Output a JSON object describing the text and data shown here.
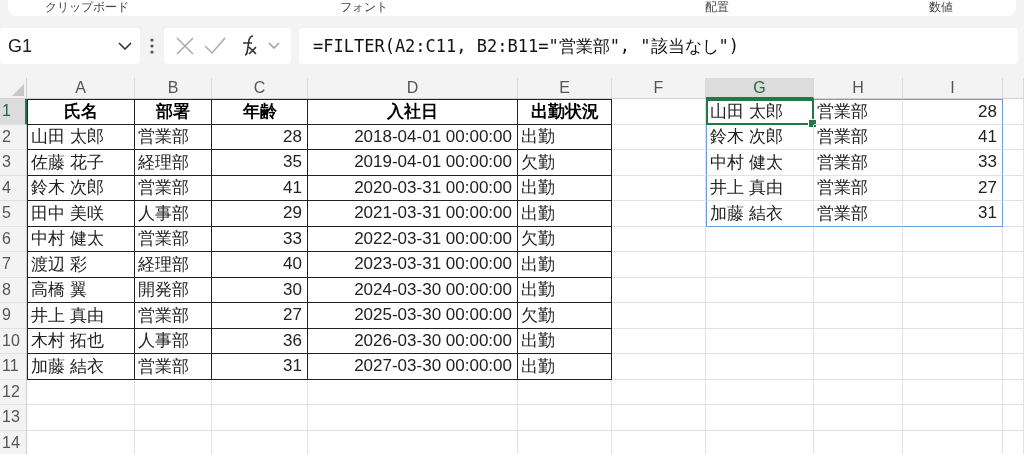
{
  "ribbon": {
    "groups": [
      "クリップボード",
      "フォント",
      "配置",
      "数値"
    ]
  },
  "formula_bar": {
    "name_box": "G1",
    "formula": "=FILTER(A2:C11, B2:B11=\"営業部\", \"該当なし\")"
  },
  "columns": [
    {
      "label": "A",
      "selected": false
    },
    {
      "label": "B",
      "selected": false
    },
    {
      "label": "C",
      "selected": false
    },
    {
      "label": "D",
      "selected": false
    },
    {
      "label": "E",
      "selected": false
    },
    {
      "label": "F",
      "selected": false
    },
    {
      "label": "G",
      "selected": true
    },
    {
      "label": "H",
      "selected": false
    },
    {
      "label": "I",
      "selected": false
    }
  ],
  "row_numbers": [
    {
      "label": "1",
      "selected": true
    },
    {
      "label": "2",
      "selected": false
    },
    {
      "label": "3",
      "selected": false
    },
    {
      "label": "4",
      "selected": false
    },
    {
      "label": "5",
      "selected": false
    },
    {
      "label": "6",
      "selected": false
    },
    {
      "label": "7",
      "selected": false
    },
    {
      "label": "8",
      "selected": false
    },
    {
      "label": "9",
      "selected": false
    },
    {
      "label": "10",
      "selected": false
    },
    {
      "label": "11",
      "selected": false
    },
    {
      "label": "12",
      "selected": false
    },
    {
      "label": "13",
      "selected": false
    },
    {
      "label": "14",
      "selected": false
    }
  ],
  "table": {
    "headers": [
      "氏名",
      "部署",
      "年齢",
      "入社日",
      "出勤状況"
    ],
    "rows": [
      [
        "山田 太郎",
        "営業部",
        "28",
        "2018-04-01 00:00:00",
        "出勤"
      ],
      [
        "佐藤 花子",
        "経理部",
        "35",
        "2019-04-01 00:00:00",
        "欠勤"
      ],
      [
        "鈴木 次郎",
        "営業部",
        "41",
        "2020-03-31 00:00:00",
        "出勤"
      ],
      [
        "田中 美咲",
        "人事部",
        "29",
        "2021-03-31 00:00:00",
        "出勤"
      ],
      [
        "中村 健太",
        "営業部",
        "33",
        "2022-03-31 00:00:00",
        "欠勤"
      ],
      [
        "渡辺 彩",
        "経理部",
        "40",
        "2023-03-31 00:00:00",
        "出勤"
      ],
      [
        "高橋 翼",
        "開発部",
        "30",
        "2024-03-30 00:00:00",
        "出勤"
      ],
      [
        "井上 真由",
        "営業部",
        "27",
        "2025-03-30 00:00:00",
        "欠勤"
      ],
      [
        "木村 拓也",
        "人事部",
        "36",
        "2026-03-30 00:00:00",
        "出勤"
      ],
      [
        "加藤 結衣",
        "営業部",
        "31",
        "2027-03-30 00:00:00",
        "出勤"
      ]
    ]
  },
  "spill": {
    "rows": [
      [
        "山田 太郎",
        "営業部",
        "28"
      ],
      [
        "鈴木 次郎",
        "営業部",
        "41"
      ],
      [
        "中村 健太",
        "営業部",
        "33"
      ],
      [
        "井上 真由",
        "営業部",
        "27"
      ],
      [
        "加藤 結衣",
        "営業部",
        "31"
      ]
    ]
  }
}
